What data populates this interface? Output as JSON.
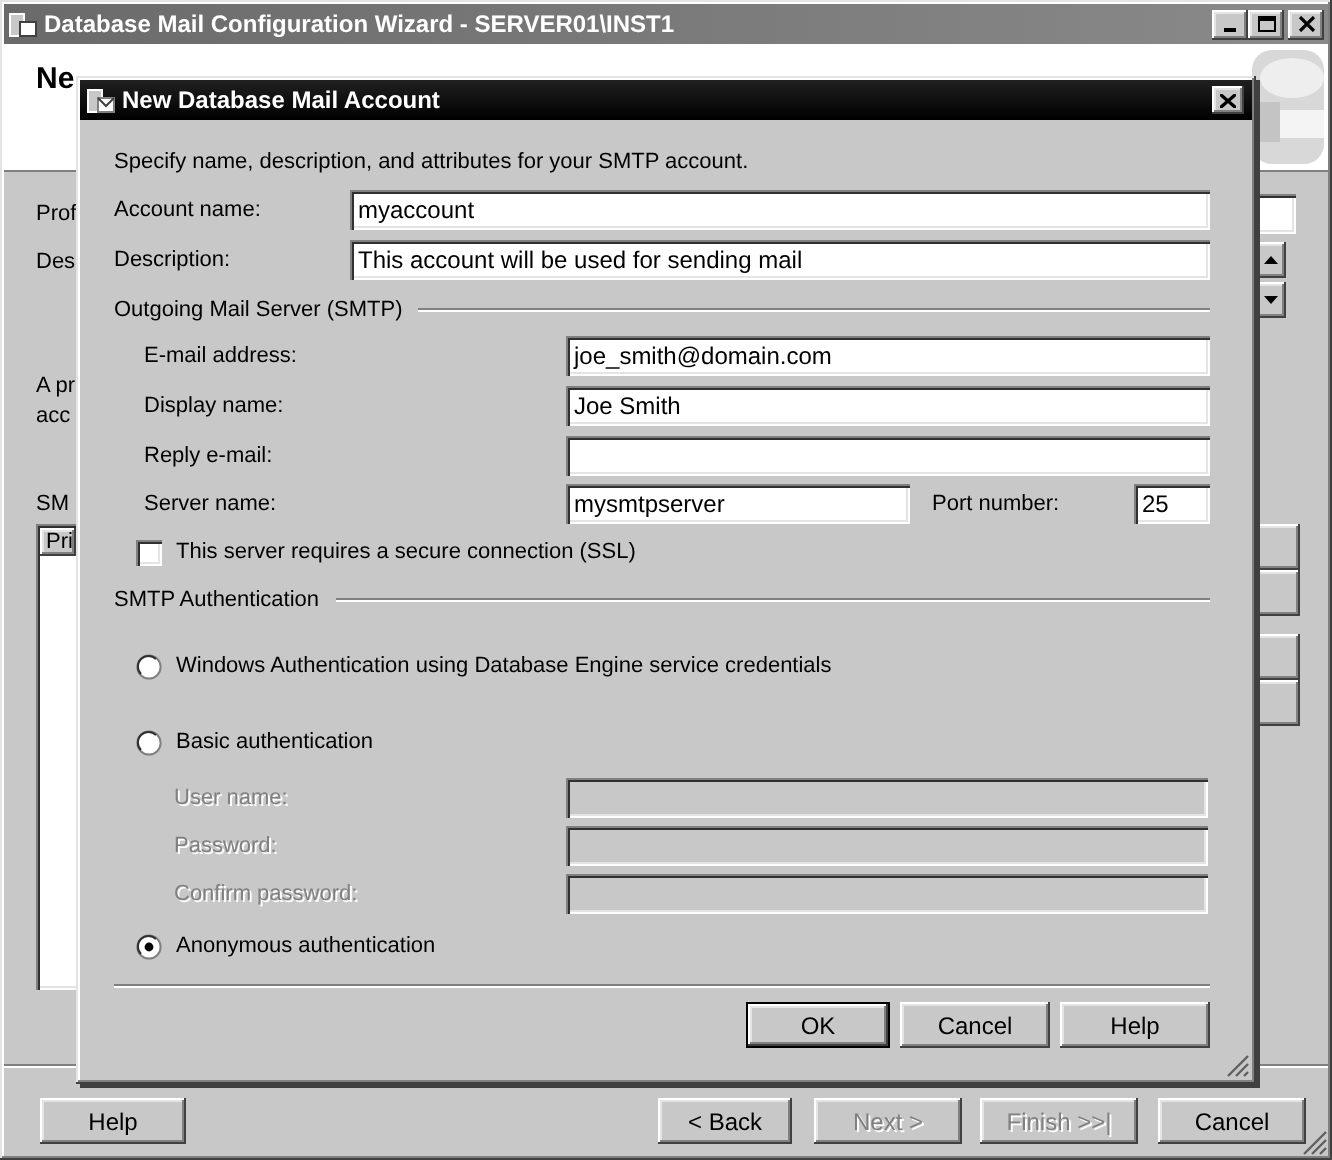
{
  "window": {
    "title": "Database Mail Configuration Wizard - SERVER01\\INST1"
  },
  "header": {
    "title": "Ne"
  },
  "page": {
    "profile_label": "Prof",
    "description_label": "Des",
    "info_lines": [
      "A pr",
      "acc"
    ],
    "smtp_label": "SM",
    "list_column": "Pri"
  },
  "buttons": [
    {
      "label": "Help",
      "disabled": false
    },
    {
      "label": "< Back",
      "disabled": false
    },
    {
      "label": "Next >",
      "disabled": true
    },
    {
      "label": "Finish >>|",
      "disabled": true
    },
    {
      "label": "Cancel",
      "disabled": false
    }
  ],
  "dialog": {
    "title": "New Database Mail Account",
    "intro": "Specify name, description, and attributes for your SMTP account.",
    "fields": [
      {
        "label": "Account name:",
        "value": "myaccount"
      },
      {
        "label": "Description:",
        "value": "This account will be used for sending mail"
      }
    ],
    "outgoing": {
      "heading": "Outgoing Mail Server (SMTP)",
      "fields": [
        {
          "label": "E-mail address:",
          "value": "joe_smith@domain.com"
        },
        {
          "label": "Display name:",
          "value": "Joe Smith"
        },
        {
          "label": "Reply e-mail:"
        }
      ],
      "server": {
        "label": "Server name:",
        "value": "mysmtpserver"
      },
      "port": {
        "label": "Port number:",
        "value": "25"
      },
      "ssl": {
        "label": "This server requires a secure connection (SSL)",
        "checked": false
      }
    },
    "auth": {
      "heading": "SMTP Authentication",
      "options": [
        {
          "label": "Windows Authentication using Database Engine service credentials",
          "selected": false
        },
        {
          "label": "Basic authentication",
          "selected": false,
          "fields": [
            {
              "label": "User name:",
              "disabled": true
            },
            {
              "label": "Password:",
              "disabled": true
            },
            {
              "label": "Confirm password:",
              "disabled": true
            }
          ]
        },
        {
          "label": "Anonymous authentication",
          "selected": true
        }
      ]
    },
    "buttons": [
      {
        "label": "OK",
        "default": true
      },
      {
        "label": "Cancel",
        "default": false
      },
      {
        "label": "Help",
        "default": false
      }
    ]
  }
}
